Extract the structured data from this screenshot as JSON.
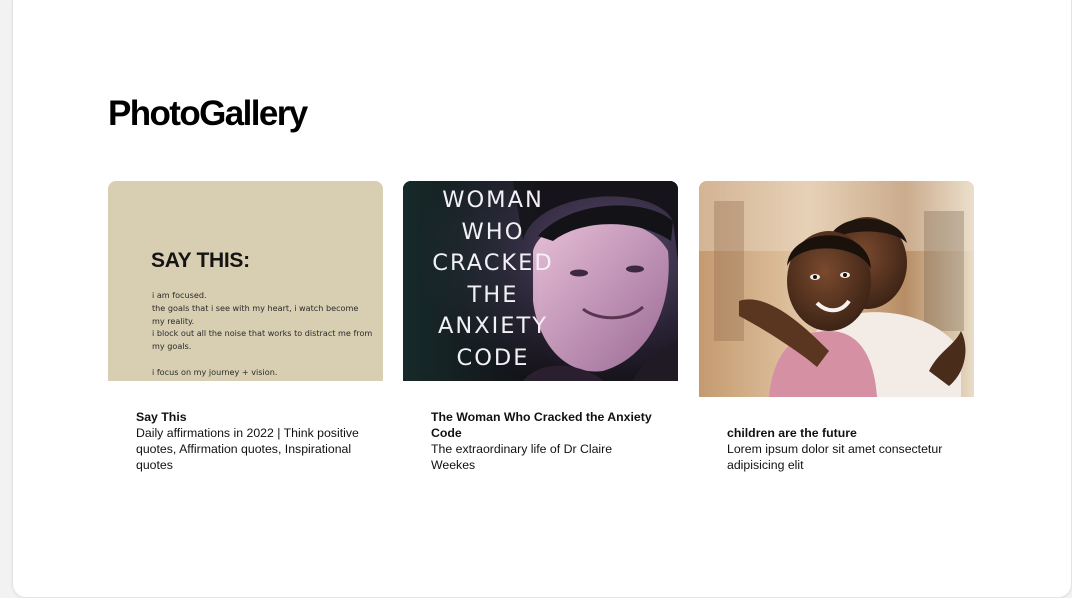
{
  "page": {
    "title": "PhotoGallery"
  },
  "cards": [
    {
      "title": "Say This",
      "description": "Daily affirmations in 2022 | Think positive quotes, Affirmation quotes, Inspirational quotes",
      "image": {
        "heading": "SAY THIS:",
        "lines": [
          "i am focused.",
          "the goals that i see with my heart, i watch become",
          "my reality.",
          "i block out all the noise that works to distract me from",
          "my goals.",
          "",
          "i focus on my journey + vision."
        ]
      }
    },
    {
      "title": "The Woman Who Cracked the Anxiety Code",
      "description": "The extraordinary life of Dr Claire Weekes",
      "image": {
        "cover_lines": [
          "WOMAN",
          "WHO",
          "CRACKED",
          "THE",
          "ANXIETY",
          "CODE"
        ]
      }
    },
    {
      "title": "children are the future",
      "description": "Lorem ipsum dolor sit amet consectetur adipisicing elit"
    }
  ],
  "colors": {
    "page_background": "#ffffff",
    "card1_background": "#d8ceb2",
    "card2_background": "#1c1a24",
    "text": "#111111"
  }
}
